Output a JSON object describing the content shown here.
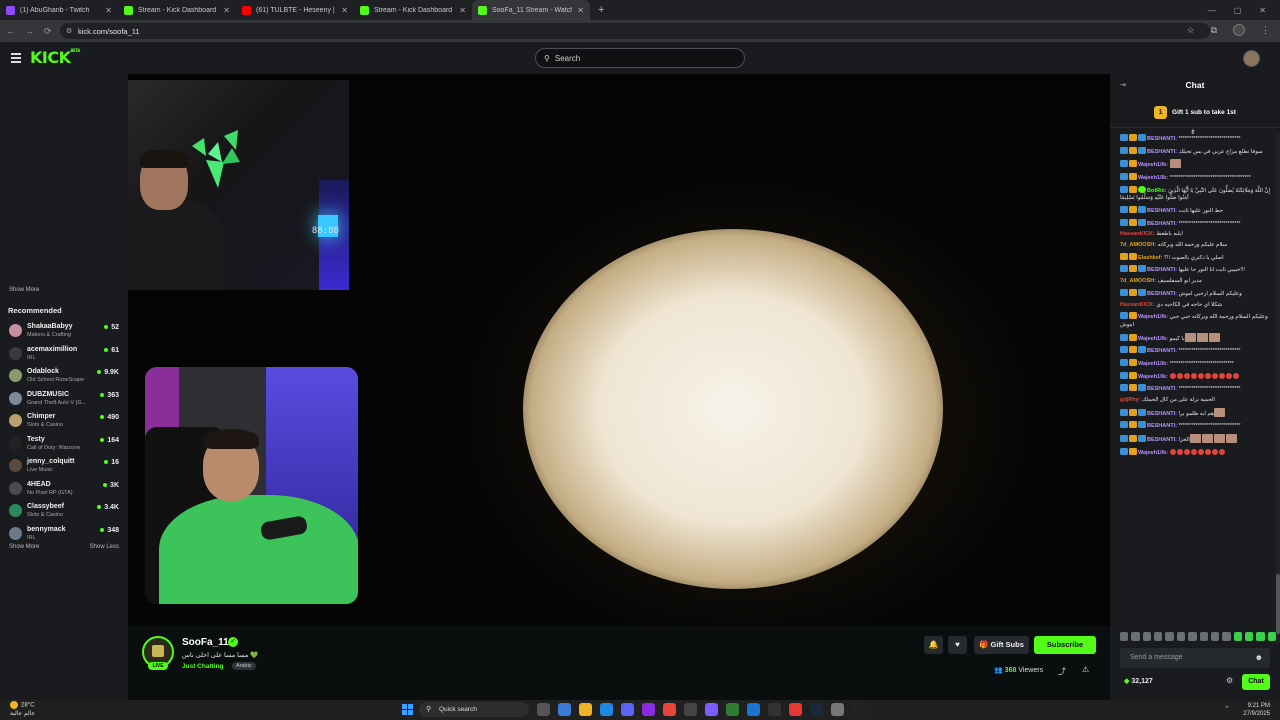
{
  "browser": {
    "tabs": [
      {
        "title": "(1) AbuGharib - Twitch",
        "color": "#9146ff",
        "active": false
      },
      {
        "title": "Stream - Kick Dashboard",
        "color": "#53fc18",
        "active": false
      },
      {
        "title": "(61) TULBTE - Heseeny | حسيني",
        "color": "#ff0000",
        "active": false
      },
      {
        "title": "Stream - Kick Dashboard",
        "color": "#53fc18",
        "active": false
      },
      {
        "title": "SooFa_11 Stream - Watch Live",
        "color": "#53fc18",
        "active": true
      }
    ],
    "new_tab": "+",
    "url": "kick.com/soofa_11"
  },
  "header": {
    "logo": "KICK",
    "logo_tm": "BETA",
    "search_placeholder": "Search"
  },
  "sidebar": {
    "show_more_top": "Show More",
    "recommended_label": "Recommended",
    "items": [
      {
        "name": "ShakaaBabyy",
        "category": "Makers & Crafting",
        "viewers": "52",
        "color": "#c98fa0"
      },
      {
        "name": "acemaximillion",
        "category": "IRL",
        "viewers": "61",
        "color": "#3a3a3a"
      },
      {
        "name": "Odablock",
        "category": "Old School RuneScape",
        "viewers": "9.9K",
        "color": "#8a9a6a"
      },
      {
        "name": "DUBZMUSIC",
        "category": "Grand Theft Auto V (G...",
        "viewers": "363",
        "color": "#7a8a9a"
      },
      {
        "name": "Chimper",
        "category": "Slots & Casino",
        "viewers": "490",
        "color": "#b8a070"
      },
      {
        "name": "Testy",
        "category": "Call of Duty: Warzone",
        "viewers": "164",
        "color": "#222222"
      },
      {
        "name": "jenny_colquitt",
        "category": "Live Music",
        "viewers": "16",
        "color": "#5a4a40"
      },
      {
        "name": "4HEAD",
        "category": "No Pixel RP (GTA)",
        "viewers": "3K",
        "color": "#4a4a50"
      },
      {
        "name": "Classybeef",
        "category": "Slots & Casino",
        "viewers": "3.4K",
        "color": "#2a8a5a"
      },
      {
        "name": "bennymack",
        "category": "IRL",
        "viewers": "348",
        "color": "#6a7a8a"
      }
    ],
    "show_more": "Show More",
    "show_less": "Show Less"
  },
  "video": {
    "clock_display": "88:88"
  },
  "stream": {
    "channel": "SooFa_11",
    "live_label": "LIVE",
    "title": "مسا مسا على احلى ناس 💚",
    "category": "Just Chatting",
    "tag": "Arabic",
    "gift_label": "Gift Subs",
    "subscribe_label": "Subscribe",
    "viewers": "368",
    "viewers_label": "Viewers"
  },
  "chat": {
    "title": "Chat",
    "gift_banner": "Gift 1 sub to take 1st",
    "gift_badge": "1",
    "messages": [
      {
        "user": "BESHANTI:",
        "color": "#b692ff",
        "badges": [
          "blue",
          "gold",
          "sub"
        ],
        "text": "*****************************"
      },
      {
        "user": "BESHANTI:",
        "color": "#b692ff",
        "badges": [
          "blue",
          "gold",
          "sub"
        ],
        "text": "سوفا تطلع مزاج عربي في بس تحيلك"
      },
      {
        "user": "Wajeeh10k:",
        "color": "#b692ff",
        "badges": [
          "blue",
          "gold"
        ],
        "text": "",
        "emotes": 1
      },
      {
        "user": "Wajeeh10k:",
        "color": "#b692ff",
        "badges": [
          "blue",
          "gold"
        ],
        "text": "**************************************"
      },
      {
        "user": "BotRix:",
        "color": "#53fc18",
        "badges": [
          "blue",
          "gold",
          "green"
        ],
        "text": "إِنَّ اللَّهَ وَمَلَائِكَتَهُ يُصَلُّونَ عَلَى النَّبِيِّ يَا أَيُّهَا الَّذِينَ آمَنُوا صَلُّوا عَلَيْهِ وَسَلِّمُوا تَسْلِيمًا"
      },
      {
        "user": "BESHANTI:",
        "color": "#b692ff",
        "badges": [
          "blue",
          "gold",
          "sub"
        ],
        "text": "حط النور عليها ثابت"
      },
      {
        "user": "BESHANTI:",
        "color": "#b692ff",
        "badges": [
          "blue",
          "gold",
          "sub"
        ],
        "text": "*****************************"
      },
      {
        "user": "HassanKICK:",
        "color": "#e3453a",
        "badges": [],
        "text": "ابلبه باطعط"
      },
      {
        "user": "7d_AMOOSH:",
        "color": "#e3a21a",
        "badges": [],
        "text": "سلام عليكم ورحمة الله وبركاته"
      },
      {
        "user": "Elashkef:",
        "color": "#e3a21a",
        "badges": [
          "gold",
          "gold"
        ],
        "text": "اصلي يا دكتري بالصوت !!؟"
      },
      {
        "user": "BESHANTI:",
        "color": "#b692ff",
        "badges": [
          "blue",
          "gold",
          "sub"
        ],
        "text": "حبيبي ثابت انا النور حا عليها!!!"
      },
      {
        "user": "7d_AMOOSH:",
        "color": "#e3a21a",
        "badges": [],
        "text": "مدير ابو السفلسيف"
      },
      {
        "user": "BESHANTI:",
        "color": "#b692ff",
        "badges": [
          "blue",
          "gold",
          "sub"
        ],
        "text": "وعليكم السلام ارحبي اموش"
      },
      {
        "user": "HassanKICK:",
        "color": "#e3453a",
        "badges": [],
        "text": "شكلا اي حاجه في الكاحيه دي"
      },
      {
        "user": "Wajeeh10k:",
        "color": "#b692ff",
        "badges": [
          "blue",
          "gold"
        ],
        "text": "وعليكم السلام ورحمة الله وبركاته حبي حبي اموش"
      },
      {
        "user": "Wajeeh10k:",
        "color": "#b692ff",
        "badges": [
          "blue",
          "gold"
        ],
        "text": "يا كيمو",
        "emotes": 3
      },
      {
        "user": "BESHANTI:",
        "color": "#b692ff",
        "badges": [
          "blue",
          "gold",
          "sub"
        ],
        "text": "*****************************"
      },
      {
        "user": "Wajeeh10k:",
        "color": "#b692ff",
        "badges": [
          "blue",
          "gold"
        ],
        "text": "******************************"
      },
      {
        "user": "Wajeeh10k:",
        "color": "#b692ff",
        "badges": [
          "blue",
          "gold"
        ],
        "text": "",
        "reds": 10
      },
      {
        "user": "BESHANTI:",
        "color": "#b692ff",
        "badges": [
          "blue",
          "gold",
          "sub"
        ],
        "text": "*****************************"
      },
      {
        "user": "gdjRhy:",
        "color": "#e3453a",
        "badges": [],
        "text": "الحمية نزلة على من كال الحملك"
      },
      {
        "user": "BESHANTI:",
        "color": "#b692ff",
        "badges": [
          "blue",
          "gold",
          "sub"
        ],
        "text": "هم ابه ظلمو برا",
        "emotes": 1
      },
      {
        "user": "BESHANTI:",
        "color": "#b692ff",
        "badges": [
          "blue",
          "gold",
          "sub"
        ],
        "text": "*****************************"
      },
      {
        "user": "BESHANTI:",
        "color": "#b692ff",
        "badges": [
          "blue",
          "gold",
          "sub"
        ],
        "text": "الخزا",
        "emotes": 4
      },
      {
        "user": "Wajeeh10k:",
        "color": "#b692ff",
        "badges": [
          "blue",
          "gold"
        ],
        "text": "",
        "reds": 8
      }
    ],
    "input_placeholder": "Send a message",
    "points": "32,127",
    "chat_button": "Chat"
  },
  "taskbar": {
    "temp": "28°C",
    "weather_note": "عالم عالية",
    "search": "Quick search",
    "time": "9:21 PM",
    "date": "27/9/2025"
  }
}
